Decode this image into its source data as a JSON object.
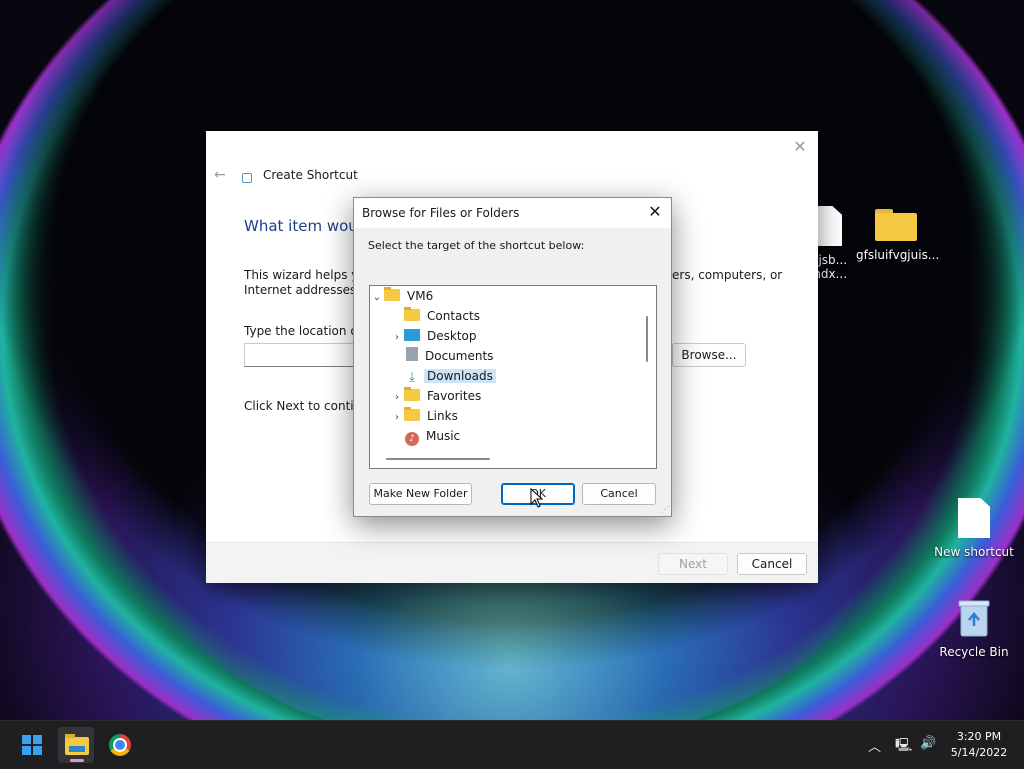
{
  "desktop": {
    "icons": [
      {
        "label_line1": "kcjsb...",
        "label_line2": "rjhdx...",
        "icon": "file-icon"
      },
      {
        "label_line1": "gfsluifvgjuis...",
        "icon": "folder-icon"
      },
      {
        "label_line1": "New shortcut",
        "icon": "shortcut-icon"
      },
      {
        "label_line1": "Recycle Bin",
        "icon": "recycle-bin-icon"
      }
    ]
  },
  "wizard": {
    "title": "Create Shortcut",
    "heading": "What item woul",
    "desc_left": "This wizard helps you Internet addresses.",
    "desc_right": "ers, computers, or",
    "type_label": "Type the location of t",
    "location_value": "",
    "browse_label": "Browse...",
    "click_next": "Click Next to continu",
    "next_label": "Next",
    "cancel_label": "Cancel"
  },
  "browse_dialog": {
    "title": "Browse for Files or Folders",
    "instruction": "Select the target of the shortcut below:",
    "tree": [
      {
        "label": "VM6",
        "icon": "folder",
        "expander": "expanded",
        "level": 0,
        "selected": false
      },
      {
        "label": "Contacts",
        "icon": "folder",
        "expander": "none",
        "level": 1,
        "selected": false
      },
      {
        "label": "Desktop",
        "icon": "desktop",
        "expander": "collapsed",
        "level": 1,
        "selected": false
      },
      {
        "label": "Documents",
        "icon": "documents",
        "expander": "none",
        "level": 1,
        "selected": false
      },
      {
        "label": "Downloads",
        "icon": "downloads",
        "expander": "none",
        "level": 1,
        "selected": true
      },
      {
        "label": "Favorites",
        "icon": "folder",
        "expander": "collapsed",
        "level": 1,
        "selected": false
      },
      {
        "label": "Links",
        "icon": "folder",
        "expander": "collapsed",
        "level": 1,
        "selected": false
      },
      {
        "label": "Music",
        "icon": "music",
        "expander": "none",
        "level": 1,
        "selected": false
      }
    ],
    "make_new_folder_label": "Make New Folder",
    "ok_label": "OK",
    "cancel_label": "Cancel"
  },
  "taskbar": {
    "time": "3:20 PM",
    "date": "5/14/2022",
    "pinned": [
      "start-button",
      "file-explorer",
      "chrome"
    ]
  },
  "colors": {
    "accent": "#0067c0",
    "selection": "#cce4f7",
    "heading": "#1e3f8a"
  }
}
